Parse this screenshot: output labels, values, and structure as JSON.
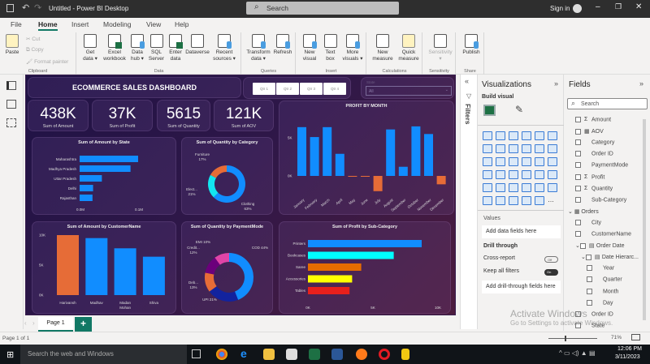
{
  "window": {
    "title": "Untitled - Power BI Desktop",
    "search_placeholder": "Search",
    "sign_in": "Sign in"
  },
  "menu": [
    "File",
    "Home",
    "Insert",
    "Modeling",
    "View",
    "Help"
  ],
  "ribbon": {
    "clipboard": {
      "label": "Clipboard",
      "paste": "Paste",
      "cut": "Cut",
      "copy": "Copy",
      "format_painter": "Format painter"
    },
    "data": {
      "label": "Data",
      "buttons": [
        [
          "Get",
          "data ▾"
        ],
        [
          "Excel",
          "workbook"
        ],
        [
          "Data",
          "hub ▾"
        ],
        [
          "SQL",
          "Server"
        ],
        [
          "Enter",
          "data"
        ],
        [
          "Dataverse",
          ""
        ],
        [
          "Recent",
          "sources ▾"
        ]
      ]
    },
    "queries": {
      "label": "Queries",
      "buttons": [
        [
          "Transform",
          "data ▾"
        ],
        [
          "Refresh",
          ""
        ]
      ]
    },
    "insert": {
      "label": "Insert",
      "buttons": [
        [
          "New",
          "visual"
        ],
        [
          "Text",
          "box"
        ],
        [
          "More",
          "visuals ▾"
        ]
      ]
    },
    "calculations": {
      "label": "Calculations",
      "buttons": [
        [
          "New",
          "measure"
        ],
        [
          "Quick",
          "measure"
        ]
      ]
    },
    "sensitivity": {
      "label": "Sensitivity",
      "buttons": [
        [
          "Sensitivity",
          "▾"
        ]
      ]
    },
    "share": {
      "label": "Share",
      "buttons": [
        [
          "Publish",
          ""
        ]
      ]
    }
  },
  "dashboard": {
    "title": "ECOMMERCE SALES DASHBOARD",
    "quarters": [
      "Qtr 1",
      "Qtr 2",
      "Qtr 3",
      "Qtr 4"
    ],
    "state_slicer": {
      "header": "State",
      "value": "All"
    },
    "kpis": [
      {
        "value": "438K",
        "label": "Sum of Amount"
      },
      {
        "value": "37K",
        "label": "Sum of Profit"
      },
      {
        "value": "5615",
        "label": "Sum of Quantity"
      },
      {
        "value": "121K",
        "label": "Sum of AOV"
      }
    ]
  },
  "chart_data": [
    {
      "id": "profit_month",
      "type": "bar",
      "title": "PROFIT BY MONTH",
      "categories": [
        "January",
        "February",
        "March",
        "April",
        "May",
        "June",
        "July",
        "August",
        "September",
        "October",
        "November",
        "December"
      ],
      "values": [
        6.4,
        5.1,
        6.4,
        2.9,
        -0.1,
        -0.1,
        -2.0,
        6.1,
        1.2,
        6.5,
        5.5,
        -1.1
      ],
      "unit": "K",
      "yticks": [
        "0K",
        "5K"
      ],
      "colors": {
        "positive": "#118dff",
        "negative": "#e66c37"
      }
    },
    {
      "id": "amount_state",
      "type": "bar",
      "orientation": "horizontal",
      "title": "Sum of Amount by State",
      "categories": [
        "Maharashtra",
        "Madhya Pradesh",
        "Uttar Pradesh",
        "Delhi",
        "Rajasthan"
      ],
      "values": [
        0.1,
        0.087,
        0.038,
        0.023,
        0.022
      ],
      "unit": "M",
      "xticks": [
        "0.0M",
        "0.1M"
      ],
      "color": "#118dff"
    },
    {
      "id": "qty_category",
      "type": "pie",
      "donut": true,
      "title": "Sum of Quantity by Category",
      "labels": [
        "Clothing",
        "Electronics",
        "Furniture"
      ],
      "display_labels": [
        "Clothing",
        "Elect...",
        " Furniture"
      ],
      "values": [
        63,
        21,
        17
      ],
      "colors": [
        "#118dff",
        "#12e5f0",
        "#e66c37"
      ]
    },
    {
      "id": "amount_customer",
      "type": "bar",
      "title": "Sum of Amount by CustomerName",
      "categories": [
        "Harivansh",
        "Madhav",
        "Madan Mohan",
        "Shiva"
      ],
      "values": [
        10.0,
        9.5,
        7.8,
        6.4
      ],
      "unit": "K",
      "yticks": [
        "0K",
        "5K",
        "10K"
      ],
      "colors": [
        "#e66c37",
        "#118dff",
        "#118dff",
        "#118dff"
      ]
    },
    {
      "id": "qty_payment",
      "type": "pie",
      "donut": true,
      "title": "Sum of Quantity by PaymentMode",
      "labels": [
        "COD",
        "UPI",
        "Debit Card",
        "Credit Card",
        "EMI"
      ],
      "display_labels": [
        "COD",
        "UPI",
        "Deb...",
        "Credit...",
        "EMI"
      ],
      "values": [
        44,
        21,
        13,
        12,
        10
      ],
      "colors": [
        "#118dff",
        "#12239e",
        "#e66c37",
        "#6b007b",
        "#e044a7"
      ]
    },
    {
      "id": "profit_subcat",
      "type": "bar",
      "orientation": "horizontal",
      "title": "Sum of Profit by Sub-Category",
      "categories": [
        "Printers",
        "Bookcases",
        "Saree",
        "Accessories",
        "Tables"
      ],
      "values": [
        8.75,
        6.6,
        4.1,
        3.4,
        3.2
      ],
      "unit": "K",
      "xticks": [
        "0K",
        "5K",
        "10K"
      ],
      "colors": [
        "#118dff",
        "#00ffff",
        "#e66c00",
        "#ffff00",
        "#e8201c"
      ]
    }
  ],
  "filters_label": "Filters",
  "visualizations": {
    "title": "Visualizations",
    "build_visual": "Build visual",
    "values_label": "Values",
    "values_placeholder": "Add data fields here",
    "drill_through": "Drill through",
    "cross_report": "Cross-report",
    "cross_report_state": "Off",
    "keep_filters": "Keep all filters",
    "keep_filters_state": "On",
    "drill_placeholder": "Add drill-through fields here",
    "visual_icon_count": 36
  },
  "fields": {
    "title": "Fields",
    "search_placeholder": "Search",
    "items": [
      {
        "label": "Amount",
        "sigma": true,
        "indent": 1
      },
      {
        "label": "AOV",
        "table": true,
        "indent": 1
      },
      {
        "label": "Category",
        "indent": 1
      },
      {
        "label": "Order ID",
        "indent": 1
      },
      {
        "label": "PaymentMode",
        "indent": 1
      },
      {
        "label": "Profit",
        "sigma": true,
        "indent": 1
      },
      {
        "label": "Quantity",
        "sigma": true,
        "indent": 1
      },
      {
        "label": "Sub-Category",
        "indent": 1
      },
      {
        "label": "Orders",
        "group": true,
        "indent": 0
      },
      {
        "label": "City",
        "indent": 1
      },
      {
        "label": "CustomerName",
        "indent": 1
      },
      {
        "label": "Order Date",
        "expand": true,
        "indent": 1
      },
      {
        "label": "Date Hierarc...",
        "expand": true,
        "indent": 2
      },
      {
        "label": "Year",
        "indent": 3
      },
      {
        "label": "Quarter",
        "indent": 3
      },
      {
        "label": "Month",
        "indent": 3
      },
      {
        "label": "Day",
        "indent": 3
      },
      {
        "label": "Order ID",
        "indent": 1
      },
      {
        "label": "State",
        "indent": 1
      }
    ]
  },
  "activation": {
    "line1": "Activate Windows",
    "line2": "Go to Settings to activate Windows."
  },
  "pages": {
    "tab": "Page 1",
    "add": "+",
    "status": "Page 1 of 1",
    "zoom": "71%"
  },
  "taskbar": {
    "search": "Search the web and Windows",
    "time": "12:06 PM",
    "date": "3/11/2023"
  }
}
